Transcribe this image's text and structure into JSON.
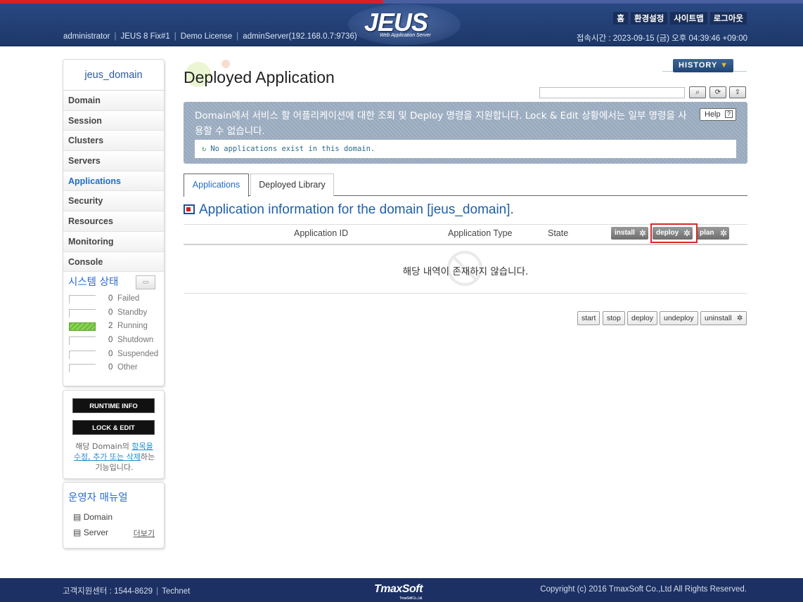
{
  "header": {
    "user": "administrator",
    "product": "JEUS 8 Fix#1",
    "license": "Demo License",
    "server": "adminServer(192.168.0.7:9736)",
    "logo": "JEUS",
    "logo_sub": "Web Application Server",
    "nav": [
      "홈",
      "환경설정",
      "사이트맵",
      "로그아웃"
    ],
    "access_time": "접속시간 : 2023-09-15 (금) 오후 04:39:46 +09:00"
  },
  "sidebar": {
    "domain_name": "jeus_domain",
    "menu": [
      {
        "label": "Domain",
        "active": false
      },
      {
        "label": "Session",
        "active": false
      },
      {
        "label": "Clusters",
        "active": false
      },
      {
        "label": "Servers",
        "active": false
      },
      {
        "label": "Applications",
        "active": true
      },
      {
        "label": "Security",
        "active": false
      },
      {
        "label": "Resources",
        "active": false
      },
      {
        "label": "Monitoring",
        "active": false
      },
      {
        "label": "Console",
        "active": false
      }
    ],
    "system_status_title": "시스템 상태",
    "status": [
      {
        "count": "0",
        "label": "Failed"
      },
      {
        "count": "0",
        "label": "Standby"
      },
      {
        "count": "2",
        "label": "Running"
      },
      {
        "count": "0",
        "label": "Shutdown"
      },
      {
        "count": "0",
        "label": "Suspended"
      },
      {
        "count": "0",
        "label": "Other"
      }
    ],
    "runtime_info": "RUNTIME INFO",
    "lock_edit": "LOCK & EDIT",
    "note_prefix": "해당 Domain의 ",
    "note_link": "항목을 수정, 추가 또는 삭제",
    "note_suffix": "하는 기능입니다.",
    "manual_title": "운영자 매뉴얼",
    "manual_links": [
      "Domain",
      "Server"
    ],
    "more": "더보기"
  },
  "main": {
    "page_title": "Deployed Application",
    "history": "HISTORY",
    "search_placeholder": "",
    "description": "Domain에서 서비스 할 어플리케이션에 대한 조회 및 Deploy 명령을 지원합니다. Lock & Edit 상황에서는 일부 명령을 사용할 수 없습니다.",
    "help": "Help",
    "message": "No applications exist in this domain.",
    "tabs": [
      {
        "label": "Applications",
        "active": true
      },
      {
        "label": "Deployed Library",
        "active": false
      }
    ],
    "section_title": "Application information for the domain [jeus_domain].",
    "columns": [
      "Application ID",
      "Application Type",
      "State"
    ],
    "header_buttons": [
      "install",
      "deploy",
      "plan"
    ],
    "empty_text": "해당 내역이 존재하지 않습니다.",
    "actions": [
      "start",
      "stop",
      "deploy",
      "undeploy",
      "uninstall"
    ]
  },
  "footer": {
    "support": "고객지원센터 : 1544-8629",
    "technet": "Technet",
    "logo": "TmaxSoft",
    "logo_sub": "TmaxSoft Co., Ltd.",
    "copyright": "Copyright (c) 2016 TmaxSoft Co.,Ltd All Rights Reserved."
  },
  "colors": {
    "header_bg": "#1d3767",
    "accent_blue": "#1e6dc4",
    "highlight_red": "#d42a2a",
    "running_green": "#6fbf3a"
  }
}
